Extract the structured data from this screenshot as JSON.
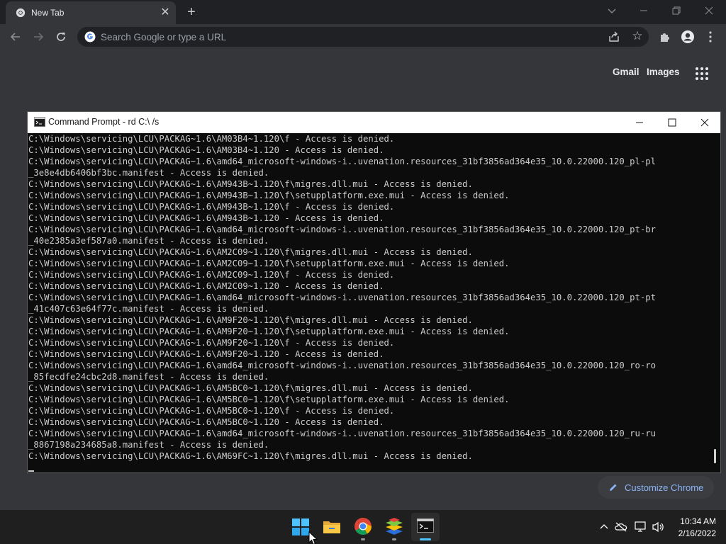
{
  "colors": {
    "chrome_frame": "#202124",
    "chrome_toolbar": "#35363a",
    "ntp_link": "#e8eaed",
    "customize_accent": "#8ab4f8",
    "console_bg": "#0c0c0c",
    "console_text": "#cccccc",
    "taskbar_bg": "#1f1f1f",
    "taskbar_active_indicator": "#4cc2ff"
  },
  "chrome": {
    "tab": {
      "title": "New Tab",
      "favicon": "chrome-icon",
      "close_icon": "close-icon"
    },
    "new_tab_icon": "plus-icon",
    "window_controls": {
      "tab_search": "chevron-down-icon",
      "minimize": "minimize-icon",
      "restore": "restore-icon",
      "close": "close-icon"
    },
    "toolbar": {
      "back": "arrow-left-icon",
      "forward": "arrow-right-icon",
      "reload": "reload-icon",
      "omnibox_placeholder": "Search Google or type a URL",
      "share": "share-icon",
      "bookmark": "star-icon",
      "extensions": "puzzle-icon",
      "profile": "person-icon",
      "menu": "kebab-menu-icon"
    },
    "ntp": {
      "gmail": "Gmail",
      "images": "Images",
      "apps": "apps-grid-icon",
      "customize_label": "Customize Chrome",
      "customize_icon": "pencil-icon"
    }
  },
  "cmd": {
    "title": "Command Prompt - rd  C:\\ /s",
    "controls": {
      "minimize": "minimize-icon",
      "maximize": "maximize-icon",
      "close": "close-icon"
    },
    "lines": [
      "C:\\Windows\\servicing\\LCU\\PACKAG~1.6\\AM03B4~1.120\\f - Access is denied.",
      "C:\\Windows\\servicing\\LCU\\PACKAG~1.6\\AM03B4~1.120 - Access is denied.",
      "C:\\Windows\\servicing\\LCU\\PACKAG~1.6\\amd64_microsoft-windows-i..uvenation.resources_31bf3856ad364e35_10.0.22000.120_pl-pl",
      "_3e8e4db6406bf3bc.manifest - Access is denied.",
      "C:\\Windows\\servicing\\LCU\\PACKAG~1.6\\AM943B~1.120\\f\\migres.dll.mui - Access is denied.",
      "C:\\Windows\\servicing\\LCU\\PACKAG~1.6\\AM943B~1.120\\f\\setupplatform.exe.mui - Access is denied.",
      "C:\\Windows\\servicing\\LCU\\PACKAG~1.6\\AM943B~1.120\\f - Access is denied.",
      "C:\\Windows\\servicing\\LCU\\PACKAG~1.6\\AM943B~1.120 - Access is denied.",
      "C:\\Windows\\servicing\\LCU\\PACKAG~1.6\\amd64_microsoft-windows-i..uvenation.resources_31bf3856ad364e35_10.0.22000.120_pt-br",
      "_40e2385a3ef587a0.manifest - Access is denied.",
      "C:\\Windows\\servicing\\LCU\\PACKAG~1.6\\AM2C09~1.120\\f\\migres.dll.mui - Access is denied.",
      "C:\\Windows\\servicing\\LCU\\PACKAG~1.6\\AM2C09~1.120\\f\\setupplatform.exe.mui - Access is denied.",
      "C:\\Windows\\servicing\\LCU\\PACKAG~1.6\\AM2C09~1.120\\f - Access is denied.",
      "C:\\Windows\\servicing\\LCU\\PACKAG~1.6\\AM2C09~1.120 - Access is denied.",
      "C:\\Windows\\servicing\\LCU\\PACKAG~1.6\\amd64_microsoft-windows-i..uvenation.resources_31bf3856ad364e35_10.0.22000.120_pt-pt",
      "_41c407c63e64f77c.manifest - Access is denied.",
      "C:\\Windows\\servicing\\LCU\\PACKAG~1.6\\AM9F20~1.120\\f\\migres.dll.mui - Access is denied.",
      "C:\\Windows\\servicing\\LCU\\PACKAG~1.6\\AM9F20~1.120\\f\\setupplatform.exe.mui - Access is denied.",
      "C:\\Windows\\servicing\\LCU\\PACKAG~1.6\\AM9F20~1.120\\f - Access is denied.",
      "C:\\Windows\\servicing\\LCU\\PACKAG~1.6\\AM9F20~1.120 - Access is denied.",
      "C:\\Windows\\servicing\\LCU\\PACKAG~1.6\\amd64_microsoft-windows-i..uvenation.resources_31bf3856ad364e35_10.0.22000.120_ro-ro",
      "_85fecdfe24cbc2d8.manifest - Access is denied.",
      "C:\\Windows\\servicing\\LCU\\PACKAG~1.6\\AM5BC0~1.120\\f\\migres.dll.mui - Access is denied.",
      "C:\\Windows\\servicing\\LCU\\PACKAG~1.6\\AM5BC0~1.120\\f\\setupplatform.exe.mui - Access is denied.",
      "C:\\Windows\\servicing\\LCU\\PACKAG~1.6\\AM5BC0~1.120\\f - Access is denied.",
      "C:\\Windows\\servicing\\LCU\\PACKAG~1.6\\AM5BC0~1.120 - Access is denied.",
      "C:\\Windows\\servicing\\LCU\\PACKAG~1.6\\amd64_microsoft-windows-i..uvenation.resources_31bf3856ad364e35_10.0.22000.120_ru-ru",
      "_8867198a234685a8.manifest - Access is denied.",
      "C:\\Windows\\servicing\\LCU\\PACKAG~1.6\\AM69FC~1.120\\f\\migres.dll.mui - Access is denied."
    ]
  },
  "taskbar": {
    "apps": [
      {
        "name": "start",
        "icon": "windows-logo-icon",
        "running": false
      },
      {
        "name": "file-explorer",
        "icon": "folder-icon",
        "running": false
      },
      {
        "name": "chrome",
        "icon": "chrome-icon",
        "running": true
      },
      {
        "name": "bluestacks",
        "icon": "bluestacks-icon",
        "running": true
      },
      {
        "name": "command-prompt",
        "icon": "terminal-icon",
        "running": true,
        "active": true
      }
    ],
    "tray": [
      "chevron-up-icon",
      "onedrive-off-icon",
      "network-icon",
      "volume-icon"
    ],
    "clock": {
      "time": "10:34 AM",
      "date": "2/16/2022"
    }
  }
}
